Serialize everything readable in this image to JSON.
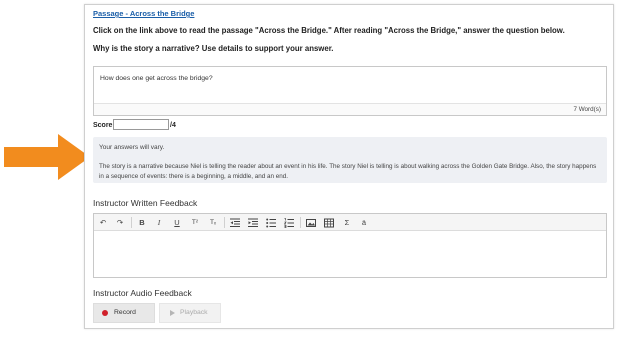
{
  "passage": {
    "link_text": "Passage - Across the Bridge"
  },
  "prompt": {
    "instruction": "Click on the link above to read the passage \"Across the Bridge.\" After reading \"Across the Bridge,\" answer the question below.",
    "question": "Why is the story a narrative? Use details to support your answer."
  },
  "answer": {
    "text": "How does one get across the bridge?",
    "word_count": "7 Word(s)"
  },
  "score": {
    "label": "Score:",
    "value": "",
    "max": "/4"
  },
  "model_answer": {
    "vary_note": "Your answers will vary.",
    "text": "The story is a narrative because Niel is telling the reader about an event in his life. The story Niel is telling is about walking across the Golden Gate Bridge. Also, the story happens in a sequence of events: there is a beginning, a middle, and an end."
  },
  "written_feedback": {
    "title": "Instructor Written Feedback",
    "toolbar": {
      "undo": "↶",
      "redo": "↷",
      "bold": "B",
      "italic": "I",
      "underline": "U",
      "superscript": "T²",
      "subscript": "Tₓ",
      "sigma": "Σ",
      "special_char": "ä"
    }
  },
  "audio_feedback": {
    "title": "Instructor Audio Feedback",
    "record_label": "Record",
    "playback_label": "Playback"
  },
  "colors": {
    "arrow": "#f28c1e",
    "link": "#1a5ea8",
    "record_dot": "#d0202a"
  }
}
